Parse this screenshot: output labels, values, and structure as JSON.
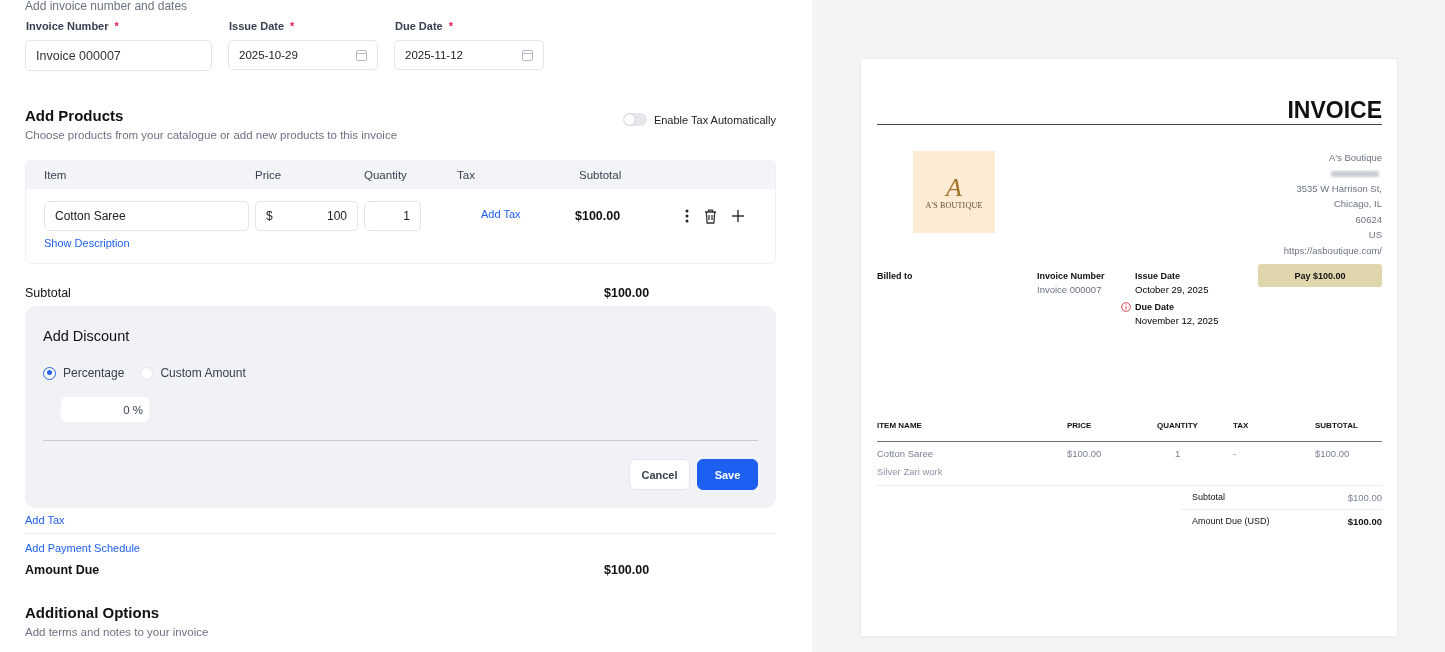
{
  "form": {
    "section_hint": "Add invoice number and dates",
    "fields": [
      {
        "label": "Invoice Number",
        "required_mark": "*",
        "value": "Invoice 000007",
        "kind": "text"
      },
      {
        "label": "Issue Date",
        "required_mark": "*",
        "value": "2025-10-29",
        "kind": "date"
      },
      {
        "label": "Due Date",
        "required_mark": "*",
        "value": "2025-11-12",
        "kind": "date"
      }
    ],
    "products": {
      "title": "Add Products",
      "subtitle": "Choose products from your catalogue or add new products to this invoice",
      "auto_tax": {
        "label": "Enable Tax Automatically",
        "on": false
      },
      "columns": [
        "Item",
        "Price",
        "Quantity",
        "Tax",
        "Subtotal"
      ],
      "rows": [
        {
          "item": "Cotton Saree",
          "currency": "$",
          "price": "100",
          "quantity": "1",
          "tax_link": "Add Tax",
          "subtotal": "$100.00",
          "description_link": "Show Description"
        }
      ]
    },
    "subtotal": {
      "label": "Subtotal",
      "value": "$100.00"
    },
    "discount": {
      "title": "Add Discount",
      "options": [
        {
          "label": "Percentage",
          "selected": true
        },
        {
          "label": "Custom Amount",
          "selected": false
        }
      ],
      "value": "0 %",
      "buttons": [
        {
          "label": "Cancel",
          "kind": "secondary"
        },
        {
          "label": "Save",
          "kind": "primary"
        }
      ]
    },
    "links": [
      "Add Tax",
      "Add Payment Schedule"
    ],
    "amount_due": {
      "label": "Amount Due",
      "value": "$100.00"
    },
    "additional": {
      "title": "Additional Options",
      "subtitle": "Add terms and notes to your invoice"
    }
  },
  "preview": {
    "title": "INVOICE",
    "logo": {
      "monogram": "A",
      "name": "A'S BOUTIQUE"
    },
    "address": [
      "A's Boutique",
      "3535 W Harrison St,",
      "Chicago, IL",
      "60624",
      "US",
      "https://asboutique.com/"
    ],
    "billed_to": "Billed to",
    "meta": [
      {
        "label": "Invoice Number",
        "value": "Invoice 000007"
      },
      {
        "label": "Issue Date",
        "value": "October 29, 2025"
      },
      {
        "label": "Due Date",
        "value": "November 12, 2025",
        "overdue": true
      }
    ],
    "pay_button": "Pay $100.00",
    "columns": [
      "ITEM NAME",
      "PRICE",
      "QUANTITY",
      "TAX",
      "SUBTOTAL"
    ],
    "rows": [
      {
        "name": "Cotton Saree",
        "description": "Silver Zari work",
        "price": "$100.00",
        "quantity": "1",
        "tax": "-",
        "subtotal": "$100.00"
      }
    ],
    "totals": [
      {
        "label": "Subtotal",
        "value": "$100.00",
        "kind": "plain"
      },
      {
        "label": "Amount Due (USD)",
        "value": "$100.00",
        "kind": "strong"
      }
    ]
  }
}
